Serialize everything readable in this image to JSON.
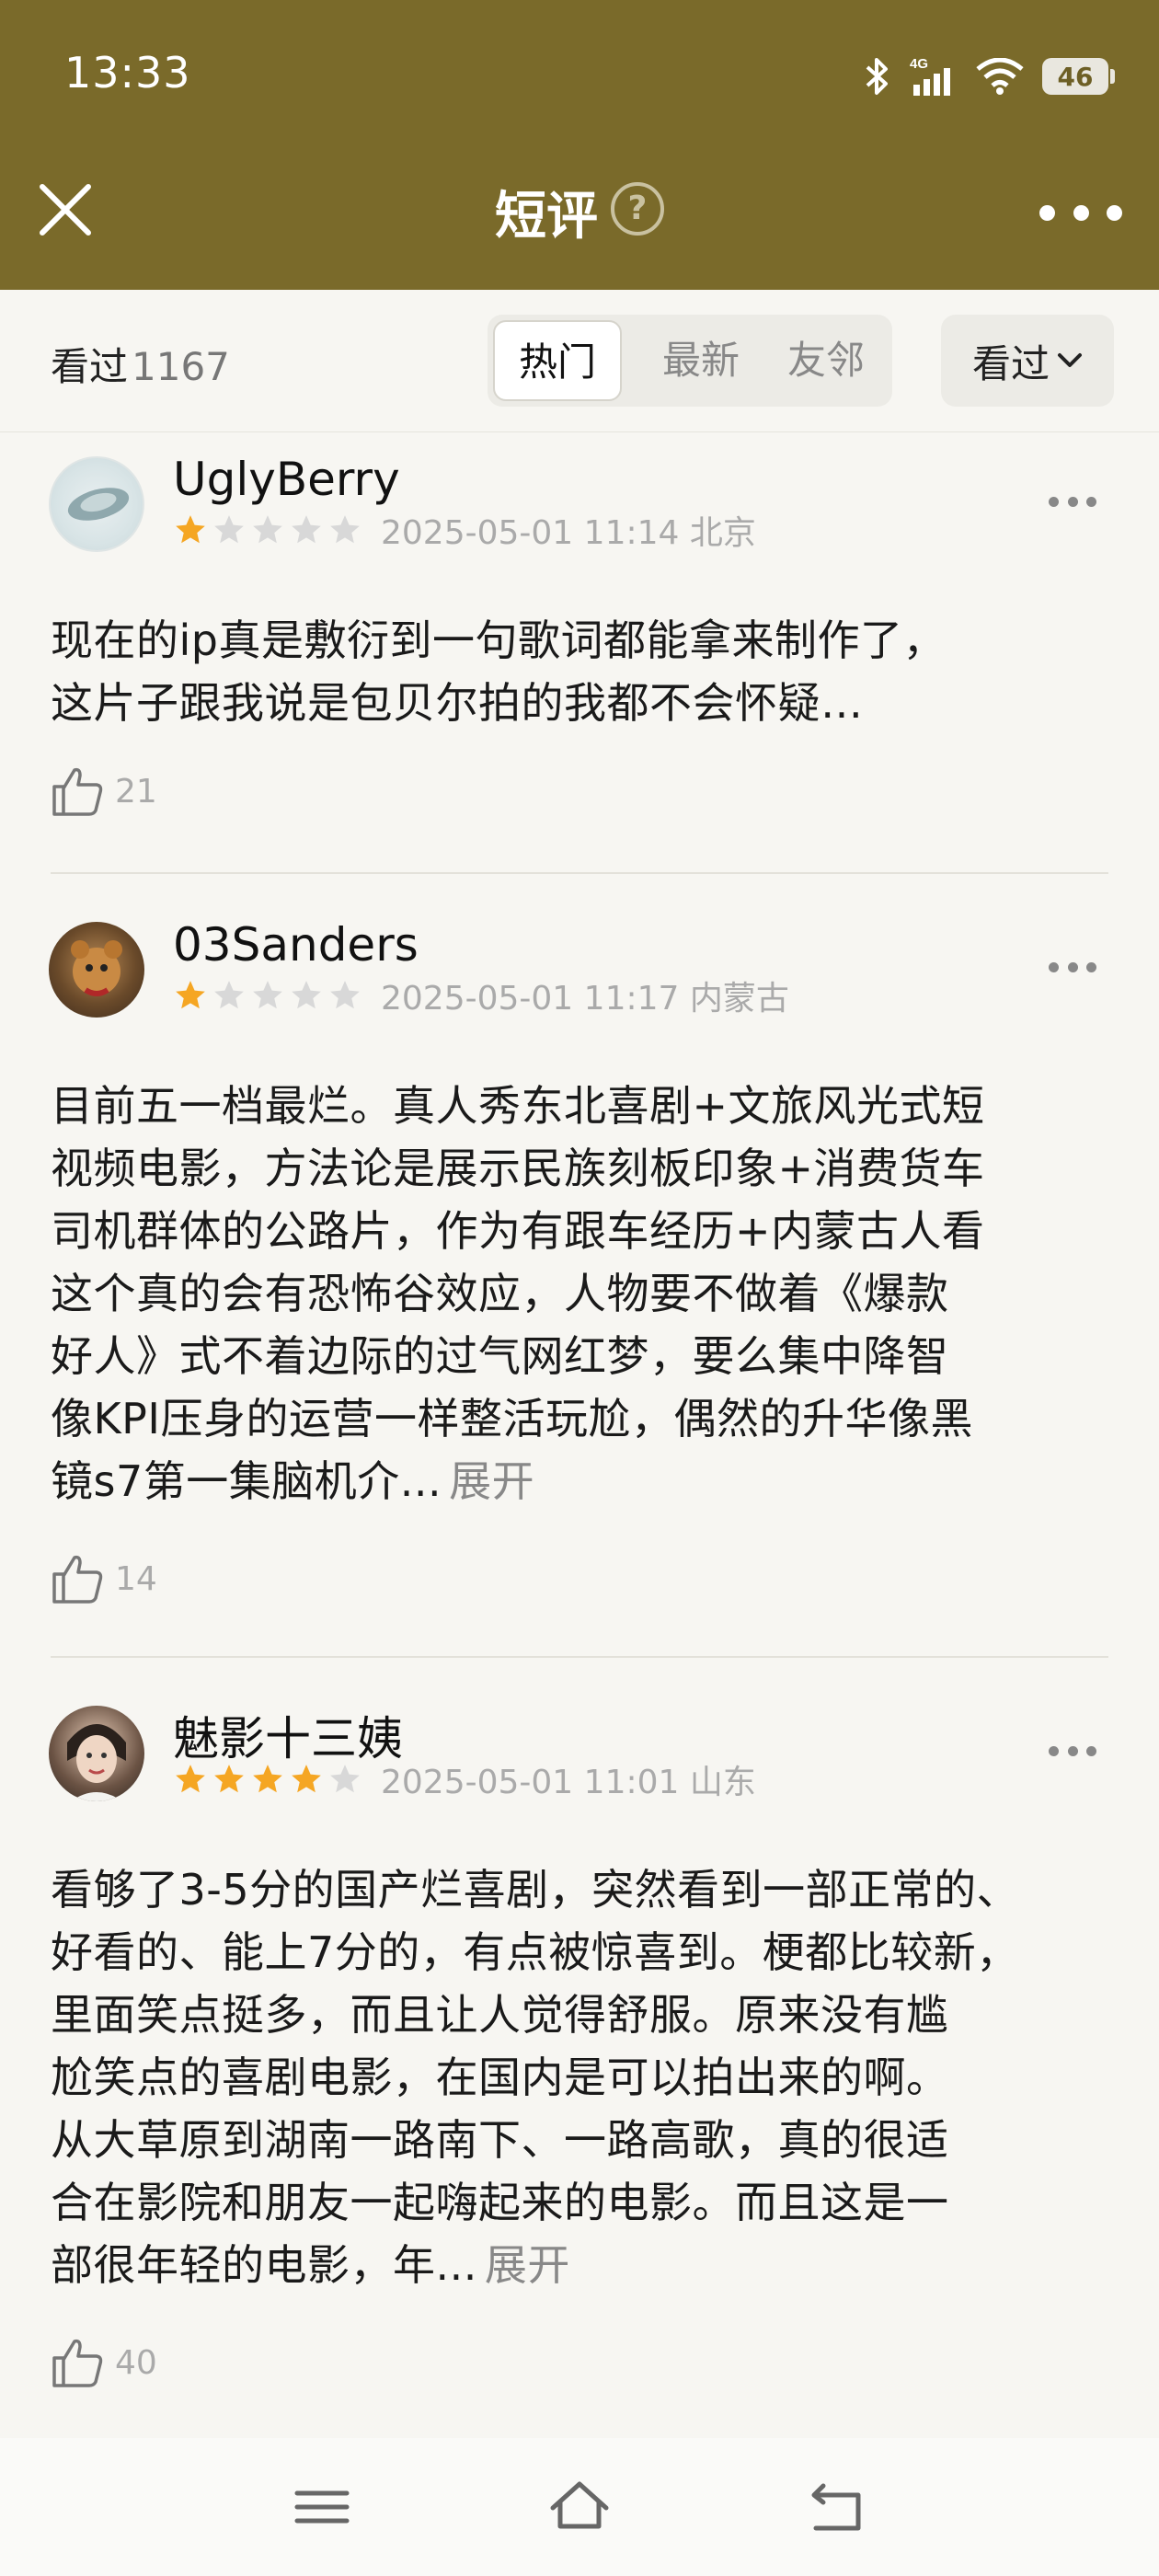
{
  "status_bar": {
    "time": "13:33",
    "network": "4G",
    "battery": "46"
  },
  "header": {
    "title": "短评",
    "help_icon": "?"
  },
  "filter": {
    "seen_label": "看过",
    "seen_count": "1167",
    "tabs": [
      {
        "label": "热门",
        "active": true
      },
      {
        "label": "最新",
        "active": false
      },
      {
        "label": "友邻",
        "active": false
      }
    ],
    "dropdown_label": "看过"
  },
  "colors": {
    "header_bg": "#7a6a2a",
    "star_on": "#f5a623",
    "star_off": "#d8d8d8"
  },
  "reviews": [
    {
      "user": "UglyBerry",
      "stars": 1,
      "meta": "2025-05-01 11:14 北京",
      "line1": "现在的ip真是敷衍到一句歌词都能拿来制作了，",
      "line2": "这片子跟我说是包贝尔拍的我都不会怀疑…",
      "expand": "",
      "likes": "21"
    },
    {
      "user": "03Sanders",
      "stars": 1,
      "meta": "2025-05-01 11:17 内蒙古",
      "lines": [
        "目前五一档最烂。真人秀东北喜剧+文旅风光式短",
        "视频电影，方法论是展示民族刻板印象+消费货车",
        "司机群体的公路片，作为有跟车经历+内蒙古人看",
        "这个真的会有恐怖谷效应，人物要不做着《爆款",
        "好人》式不着边际的过气网红梦，要么集中降智",
        "像KPI压身的运营一样整活玩尬，偶然的升华像黑",
        "镜s7第一集脑机介..."
      ],
      "expand": "展开",
      "likes": "14"
    },
    {
      "user": "魅影十三姨",
      "stars": 4,
      "meta": "2025-05-01 11:01 山东",
      "lines": [
        "看够了3-5分的国产烂喜剧，突然看到一部正常的、",
        "好看的、能上7分的，有点被惊喜到。梗都比较新，",
        "里面笑点挺多，而且让人觉得舒服。原来没有尴",
        "尬笑点的喜剧电影，在国内是可以拍出来的啊。",
        "从大草原到湖南一路南下、一路高歌，真的很适",
        "合在影院和朋友一起嗨起来的电影。而且这是一",
        "部很年轻的电影，年..."
      ],
      "expand": "展开",
      "likes": "40"
    }
  ]
}
